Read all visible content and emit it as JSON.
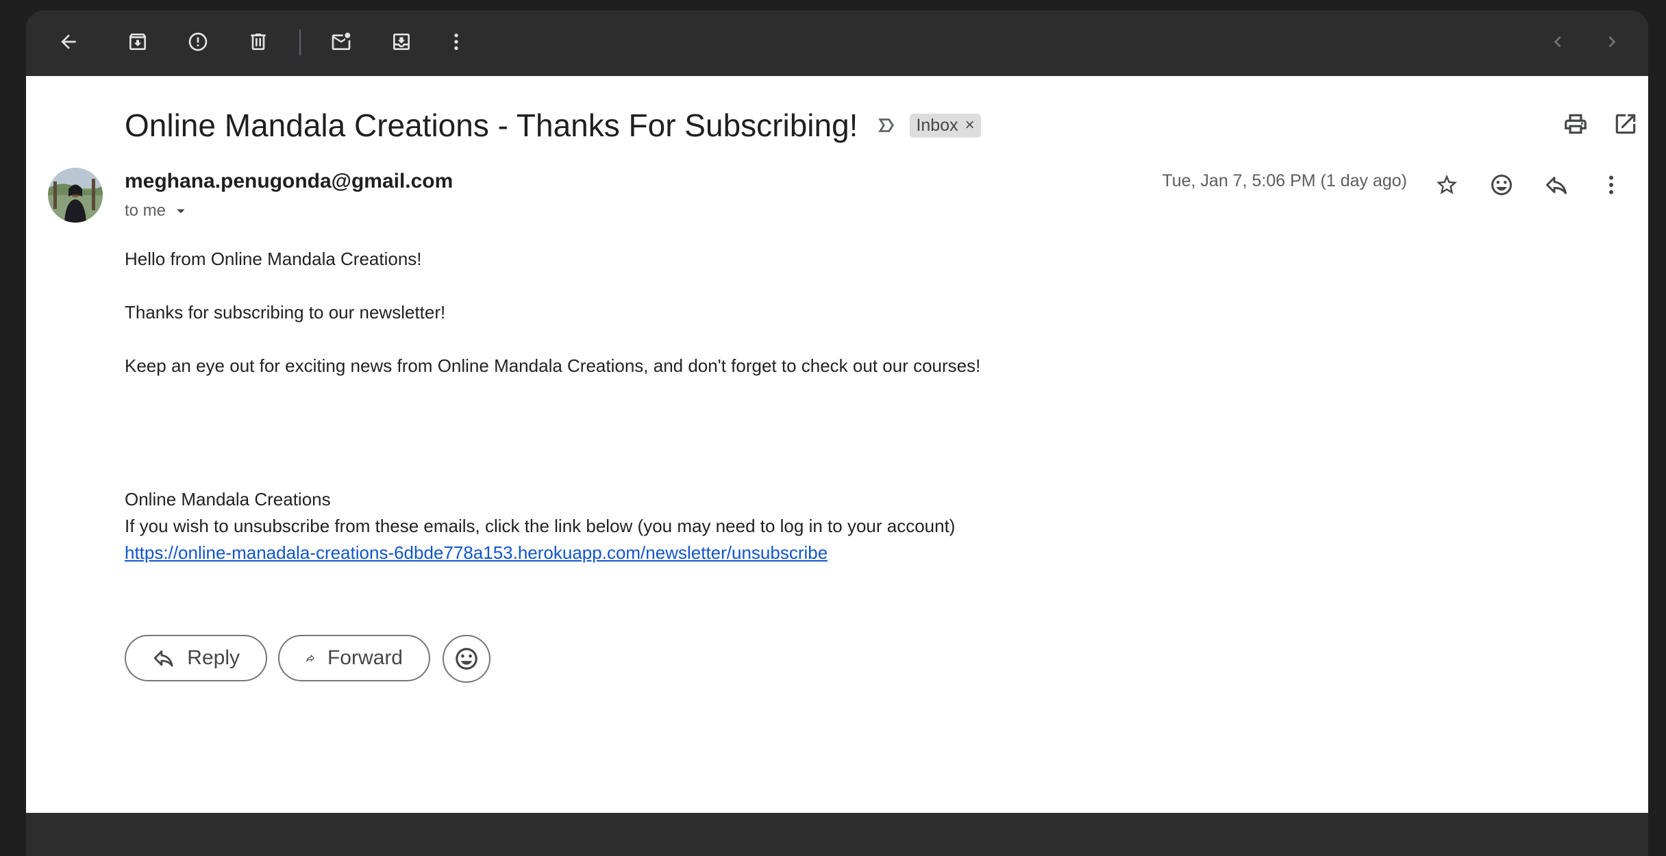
{
  "toolbar": {
    "icons": [
      "back-icon",
      "archive-icon",
      "report-spam-icon",
      "delete-icon",
      "mark-unread-icon",
      "move-to-icon",
      "more-vert-icon",
      "newer-icon",
      "older-icon"
    ]
  },
  "email": {
    "subject": "Online Mandala Creations - Thanks For Subscribing!",
    "label_chip": "Inbox",
    "label_chip_remove": "×",
    "sender": "meghana.penugonda@gmail.com",
    "recipient_text": "to me",
    "date": "Tue, Jan 7, 5:06 PM (1 day ago)",
    "body": {
      "greeting": "Hello from Online Mandala Creations!",
      "thanks": "Thanks for subscribing to our newsletter!",
      "keep_eye": "Keep an eye out for exciting news from Online Mandala Creations, and don't forget to check out our courses!",
      "signature": "Online Mandala Creations",
      "unsubscribe_text": "If you wish to unsubscribe from these emails, click the link below (you may need to log in to your account)",
      "unsubscribe_link": "https://online-manadala-creations-6dbde778a153.herokuapp.com/newsletter/unsubscribe"
    }
  },
  "actions": {
    "reply_label": "Reply",
    "forward_label": "Forward"
  },
  "colors": {
    "chrome": "#2d2d2d",
    "link": "#1155cc",
    "chip_bg": "#dddddd"
  }
}
